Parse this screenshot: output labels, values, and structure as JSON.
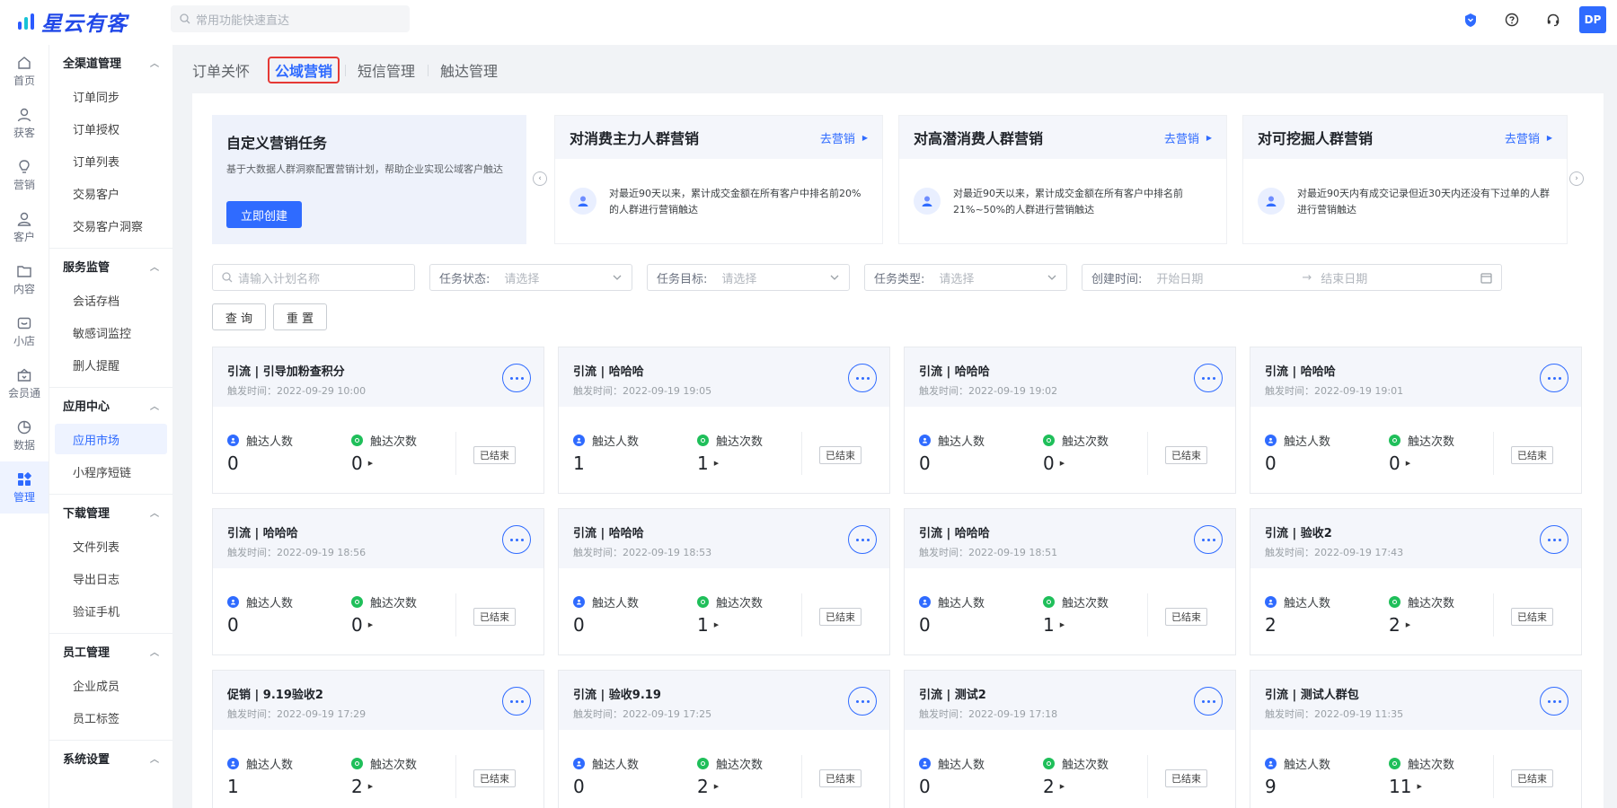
{
  "brand": {
    "name": "星云有客"
  },
  "search": {
    "placeholder": "常用功能快速直达"
  },
  "header": {
    "avatar_text": "DP"
  },
  "primary_nav": [
    {
      "label": "首页",
      "icon": "home-icon"
    },
    {
      "label": "获客",
      "icon": "user-plus-icon"
    },
    {
      "label": "营销",
      "icon": "bulb-icon"
    },
    {
      "label": "客户",
      "icon": "user-icon"
    },
    {
      "label": "内容",
      "icon": "folder-icon"
    },
    {
      "label": "小店",
      "icon": "shop-icon"
    },
    {
      "label": "会员通",
      "icon": "member-icon"
    },
    {
      "label": "数据",
      "icon": "chart-pie-icon"
    },
    {
      "label": "管理",
      "icon": "grid-icon"
    }
  ],
  "secondary_nav": [
    {
      "title": "全渠道管理",
      "items": [
        "订单同步",
        "订单授权",
        "订单列表",
        "交易客户",
        "交易客户洞察"
      ]
    },
    {
      "title": "服务监管",
      "items": [
        "会话存档",
        "敏感词监控",
        "删人提醒"
      ]
    },
    {
      "title": "应用中心",
      "items": [
        "应用市场",
        "小程序短链"
      ]
    },
    {
      "title": "下载管理",
      "items": [
        "文件列表",
        "导出日志",
        "验证手机"
      ]
    },
    {
      "title": "员工管理",
      "items": [
        "企业成员",
        "员工标签"
      ]
    },
    {
      "title": "系统设置",
      "items": []
    }
  ],
  "tabs": [
    "订单关怀",
    "公域营销",
    "短信管理",
    "触达管理"
  ],
  "custom_task": {
    "title": "自定义营销任务",
    "desc": "基于大数据人群洞察配置营销计划，帮助企业实现公域客户触达",
    "button": "立即创建"
  },
  "segments": [
    {
      "title": "对消费主力人群营销",
      "go": "去营销",
      "desc": "对最近90天以来，累计成交金额在所有客户中排名前20%的人群进行营销触达"
    },
    {
      "title": "对高潜消费人群营销",
      "go": "去营销",
      "desc": "对最近90天以来，累计成交金额在所有客户中排名前21%~50%的人群进行营销触达"
    },
    {
      "title": "对可挖掘人群营销",
      "go": "去营销",
      "desc": "对最近90天内有成交记录但近30天内还没有下过单的人群进行营销触达"
    }
  ],
  "filters": {
    "name_placeholder": "请输入计划名称",
    "status_label": "任务状态:",
    "goal_label": "任务目标:",
    "type_label": "任务类型:",
    "select_placeholder": "请选择",
    "created_label": "创建时间:",
    "start_placeholder": "开始日期",
    "end_placeholder": "结束日期",
    "query_button": "查 询",
    "reset_button": "重 置"
  },
  "stat_labels": {
    "reach_people": "触达人数",
    "reach_times": "触达次数"
  },
  "tasks": [
    {
      "title": "引流 | 引导加粉查积分",
      "time": "触发时间：2022-09-29 10:00",
      "people": "0",
      "times": "0",
      "status": "已结束"
    },
    {
      "title": "引流 | 哈哈哈",
      "time": "触发时间：2022-09-19 19:05",
      "people": "1",
      "times": "1",
      "status": "已结束"
    },
    {
      "title": "引流 | 哈哈哈",
      "time": "触发时间：2022-09-19 19:02",
      "people": "0",
      "times": "0",
      "status": "已结束"
    },
    {
      "title": "引流 | 哈哈哈",
      "time": "触发时间：2022-09-19 19:01",
      "people": "0",
      "times": "0",
      "status": "已结束"
    },
    {
      "title": "引流 | 哈哈哈",
      "time": "触发时间：2022-09-19 18:56",
      "people": "0",
      "times": "0",
      "status": "已结束"
    },
    {
      "title": "引流 | 哈哈哈",
      "time": "触发时间：2022-09-19 18:53",
      "people": "0",
      "times": "1",
      "status": "已结束"
    },
    {
      "title": "引流 | 哈哈哈",
      "time": "触发时间：2022-09-19 18:51",
      "people": "0",
      "times": "1",
      "status": "已结束"
    },
    {
      "title": "引流 | 验收2",
      "time": "触发时间：2022-09-19 17:43",
      "people": "2",
      "times": "2",
      "status": "已结束"
    },
    {
      "title": "促销 | 9.19验收2",
      "time": "触发时间：2022-09-19 17:29",
      "people": "1",
      "times": "2",
      "status": "已结束"
    },
    {
      "title": "引流 | 验收9.19",
      "time": "触发时间：2022-09-19 17:25",
      "people": "0",
      "times": "2",
      "status": "已结束"
    },
    {
      "title": "引流 | 测试2",
      "time": "触发时间：2022-09-19 17:18",
      "people": "0",
      "times": "2",
      "status": "已结束"
    },
    {
      "title": "引流 | 测试人群包",
      "time": "触发时间：2022-09-19 11:35",
      "people": "9",
      "times": "11",
      "status": "已结束"
    }
  ],
  "colors": {
    "primary": "#2f6bff",
    "highlight": "#e53935",
    "success": "#1fbf5a"
  }
}
